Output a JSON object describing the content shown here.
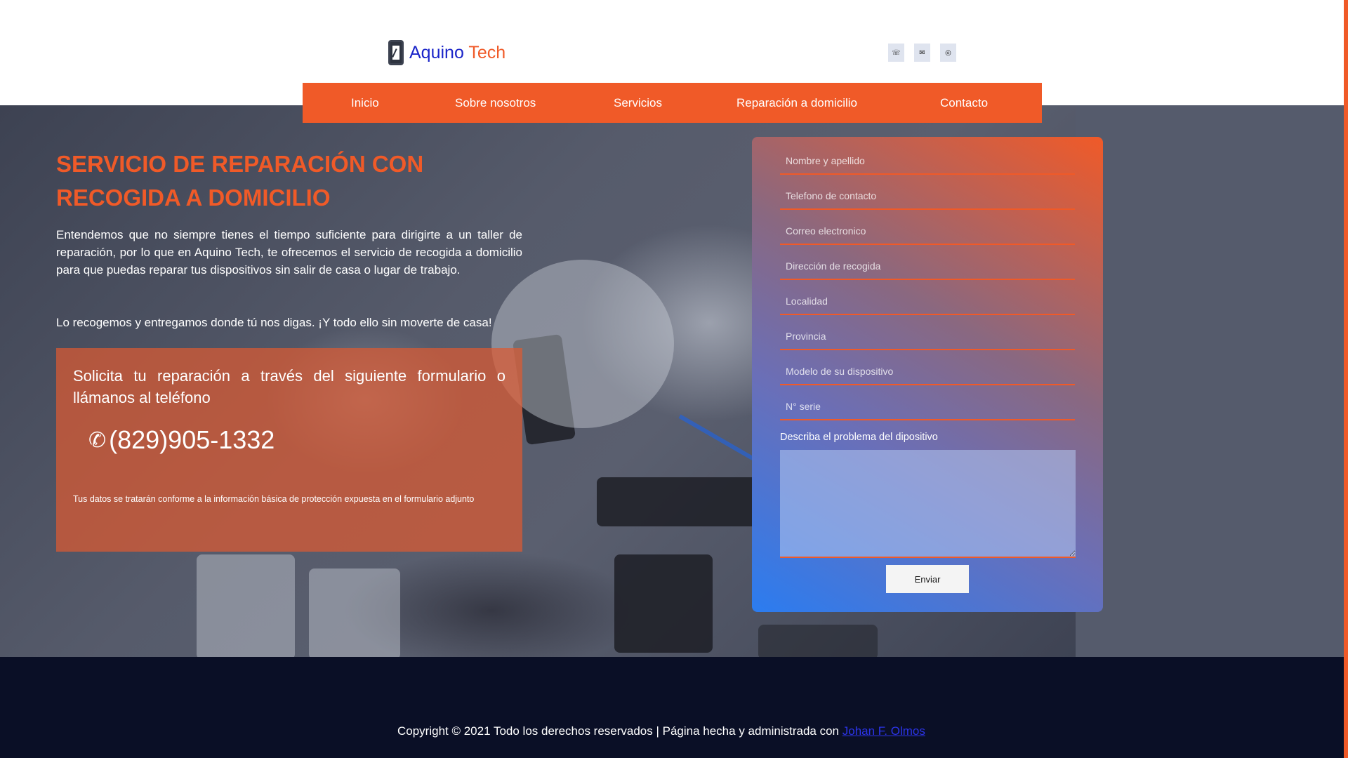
{
  "brand": {
    "name_part1": "Aquino",
    "name_part2": "Tech"
  },
  "social": [
    {
      "icon": "whatsapp-icon",
      "glyph": "☏"
    },
    {
      "icon": "mail-icon",
      "glyph": "✉"
    },
    {
      "icon": "instagram-icon",
      "glyph": "◎"
    }
  ],
  "nav": {
    "items": [
      {
        "label": "Inicio"
      },
      {
        "label": "Sobre nosotros"
      },
      {
        "label": "Servicios"
      },
      {
        "label": "Reparación a domicilio"
      },
      {
        "label": "Contacto"
      }
    ]
  },
  "hero": {
    "title": "SERVICIO DE REPARACIÓN CON RECOGIDA A DOMICILIO",
    "paragraph1": "Entendemos que no siempre tienes el tiempo suficiente para dirigirte a un taller de reparación, por lo que en Aquino Tech, te ofrecemos el servicio de recogida a domicilio para que puedas reparar tus dispositivos sin salir de casa o lugar de trabajo.",
    "paragraph2": "Lo recogemos y entregamos donde tú nos digas. ¡Y todo ello sin moverte de casa!"
  },
  "cta": {
    "text": "Solicita tu reparación a través del siguiente formulario o llámanos al teléfono",
    "phone": "(829)905-1332",
    "note": "Tus datos se tratarán conforme a la información básica de protección expuesta en el formulario adjunto"
  },
  "form": {
    "fields": [
      {
        "placeholder": "Nombre y apellido",
        "value": ""
      },
      {
        "placeholder": "Telefono de contacto",
        "value": ""
      },
      {
        "placeholder": "Correo electronico",
        "value": ""
      },
      {
        "placeholder": "Dirección de recogida",
        "value": ""
      },
      {
        "placeholder": "Localidad",
        "value": ""
      },
      {
        "placeholder": "Provincia",
        "value": ""
      },
      {
        "placeholder": "Modelo de su dispositivo",
        "value": ""
      },
      {
        "placeholder": "N° serie",
        "value": ""
      }
    ],
    "description_label": "Describa el problema del dipositivo",
    "submit_label": "Enviar"
  },
  "footer": {
    "copyright": "Copyright © 2021 Todo los derechos reservados | Página hecha y administrada con ",
    "author_link": "Johan F. Olmos"
  },
  "colors": {
    "accent": "#f05a28",
    "brand_blue": "#1b25c9",
    "footer_bg": "#0a0f26",
    "hero_overlay": "#555b6c"
  }
}
